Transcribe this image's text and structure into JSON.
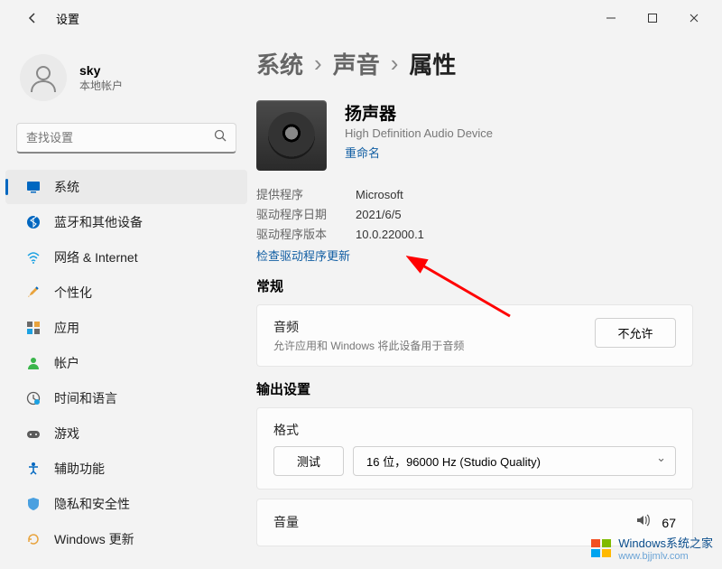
{
  "window": {
    "title": "设置"
  },
  "user": {
    "name": "sky",
    "type": "本地帐户"
  },
  "search": {
    "placeholder": "查找设置"
  },
  "nav": [
    {
      "label": "系统",
      "icon": "display"
    },
    {
      "label": "蓝牙和其他设备",
      "icon": "bluetooth"
    },
    {
      "label": "网络 & Internet",
      "icon": "wifi"
    },
    {
      "label": "个性化",
      "icon": "brush"
    },
    {
      "label": "应用",
      "icon": "apps"
    },
    {
      "label": "帐户",
      "icon": "person"
    },
    {
      "label": "时间和语言",
      "icon": "time"
    },
    {
      "label": "游戏",
      "icon": "game"
    },
    {
      "label": "辅助功能",
      "icon": "accessibility"
    },
    {
      "label": "隐私和安全性",
      "icon": "shield"
    },
    {
      "label": "Windows 更新",
      "icon": "update"
    }
  ],
  "breadcrumb": {
    "a": "系统",
    "b": "声音",
    "c": "属性"
  },
  "device": {
    "name": "扬声器",
    "desc": "High Definition Audio Device",
    "rename": "重命名"
  },
  "driver": {
    "provider_label": "提供程序",
    "provider": "Microsoft",
    "date_label": "驱动程序日期",
    "date": "2021/6/5",
    "version_label": "驱动程序版本",
    "version": "10.0.22000.1",
    "check_update": "检查驱动程序更新"
  },
  "sections": {
    "general": "常规",
    "output": "输出设置"
  },
  "audio_card": {
    "title": "音频",
    "desc": "允许应用和 Windows 将此设备用于音频",
    "button": "不允许"
  },
  "format_card": {
    "title": "格式",
    "test_btn": "测试",
    "selected": "16 位，96000 Hz (Studio Quality)"
  },
  "volume": {
    "title": "音量",
    "value": "67"
  },
  "watermark": {
    "brand": "Windows系统之家",
    "url": "www.bjjmlv.com"
  }
}
